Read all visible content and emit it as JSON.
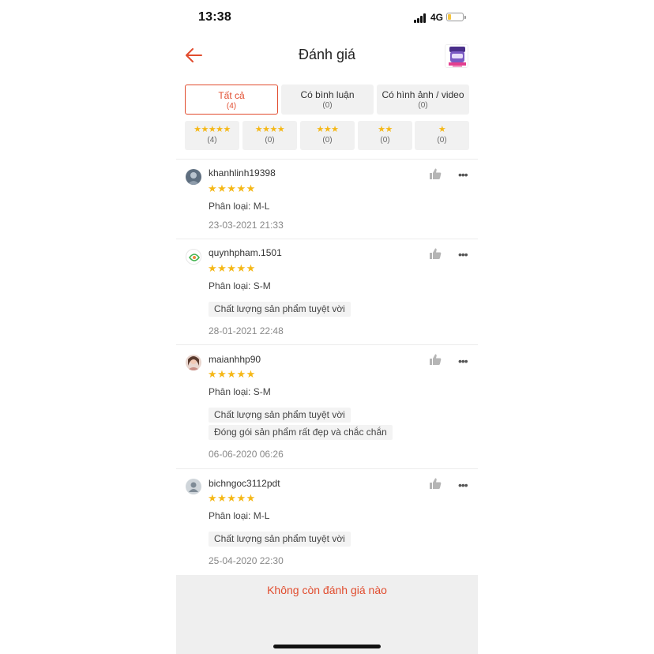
{
  "status_bar": {
    "time": "13:38",
    "network": "4G"
  },
  "header": {
    "title": "Đánh giá",
    "back_icon": "arrow-left-icon",
    "product_thumbnail": "product-thumbnail"
  },
  "filter_tabs": [
    {
      "label": "Tất cả",
      "count": "(4)",
      "active": true
    },
    {
      "label": "Có bình luận",
      "count": "(0)",
      "active": false
    },
    {
      "label": "Có hình ảnh / video",
      "count": "(0)",
      "active": false
    }
  ],
  "star_filters": [
    {
      "stars": "★★★★★",
      "count": "(4)"
    },
    {
      "stars": "★★★★",
      "count": "(0)"
    },
    {
      "stars": "★★★",
      "count": "(0)"
    },
    {
      "stars": "★★",
      "count": "(0)"
    },
    {
      "stars": "★",
      "count": "(0)"
    }
  ],
  "reviews": [
    {
      "username": "khanhlinh19398",
      "rating": 5,
      "stars": "★★★★★",
      "variant": "Phân loại: M-L",
      "tags": [],
      "date": "23-03-2021 21:33"
    },
    {
      "username": "quynhpham.1501",
      "rating": 5,
      "stars": "★★★★★",
      "variant": "Phân loại: S-M",
      "tags": [
        "Chất lượng sản phẩm tuyệt vời"
      ],
      "date": "28-01-2021 22:48"
    },
    {
      "username": "maianhhp90",
      "rating": 5,
      "stars": "★★★★★",
      "variant": "Phân loại: S-M",
      "tags": [
        "Chất lượng sản phẩm tuyệt vời",
        "Đóng gói sản phẩm rất đẹp và chắc chắn"
      ],
      "date": "06-06-2020 06:26"
    },
    {
      "username": "bichngoc3112pdt",
      "rating": 5,
      "stars": "★★★★★",
      "variant": "Phân loại: M-L",
      "tags": [
        "Chất lượng sản phẩm tuyệt vời"
      ],
      "date": "25-04-2020 22:30"
    }
  ],
  "footer": {
    "text": "Không còn đánh giá nào"
  },
  "colors": {
    "accent": "#e14c2e",
    "star": "#f5b818",
    "chip_bg": "#f1f1f1"
  }
}
